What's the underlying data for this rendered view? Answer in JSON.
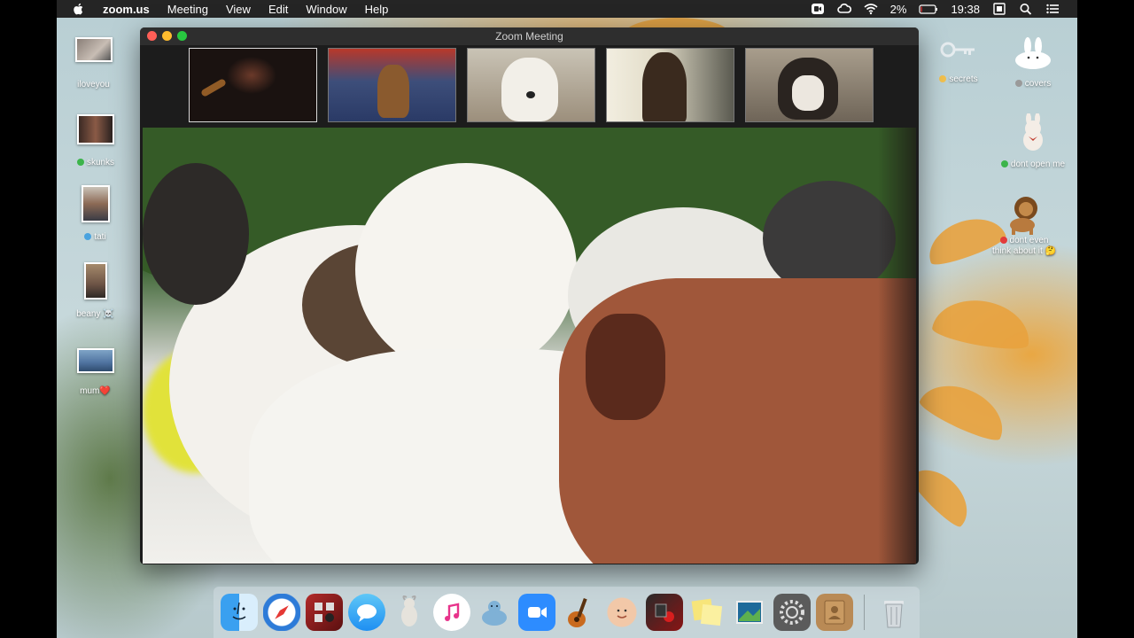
{
  "menubar": {
    "apple_icon": "apple-icon",
    "app_name": "zoom.us",
    "items": [
      "Meeting",
      "View",
      "Edit",
      "Window",
      "Help"
    ],
    "battery": "2%",
    "time": "19:38",
    "status_icons": [
      "zoom-status-icon",
      "creative-cloud-icon",
      "wifi-icon",
      "battery-icon",
      "display-icon",
      "search-icon",
      "notification-center-icon"
    ]
  },
  "desktop": {
    "left_icons": [
      {
        "label": "iloveyou",
        "status_color": ""
      },
      {
        "label": "skunks",
        "status_color": "#3cb44b"
      },
      {
        "label": "tati",
        "status_color": "#4aa3df"
      },
      {
        "label": "beany ☠️",
        "status_color": ""
      },
      {
        "label": "mum❤️",
        "status_color": ""
      }
    ],
    "right_icons": [
      {
        "label": "secrets",
        "status_color": "#f2c14e"
      },
      {
        "label": "covers",
        "status_color": "#9a9a9a"
      },
      {
        "label": "dont open me",
        "status_color": "#3cb44b"
      },
      {
        "label_line1": "dont even",
        "label_line2": "think about it 🤔",
        "status_color": "#e23b3b"
      }
    ]
  },
  "zoom": {
    "window_title": "Zoom Meeting",
    "participants": [
      {
        "name": "participant-person-dark",
        "active": true
      },
      {
        "name": "participant-dachshund",
        "active": false
      },
      {
        "name": "participant-white-dog",
        "active": false
      },
      {
        "name": "participant-woman",
        "active": false
      },
      {
        "name": "participant-husky",
        "active": false
      }
    ]
  },
  "dock": {
    "apps": [
      "finder-icon",
      "safari-icon",
      "photo-booth-icon",
      "messages-icon",
      "goat-icon",
      "itunes-icon",
      "seal-icon",
      "zoom-icon",
      "garageband-icon",
      "memoji-icon",
      "photo-app-icon",
      "stickies-icon",
      "preview-icon",
      "system-preferences-icon",
      "contacts-icon"
    ],
    "trash": "trash-icon"
  },
  "colors": {
    "menubar_bg": "#282828",
    "zoom_blue": "#2d8cff",
    "traffic_red": "#fe5f57",
    "traffic_yellow": "#febc2e",
    "traffic_green": "#28c840"
  }
}
